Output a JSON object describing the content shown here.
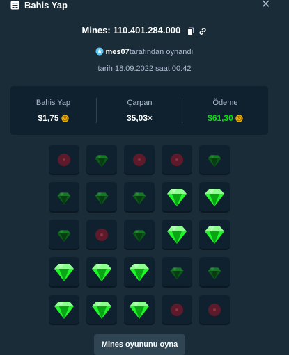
{
  "header": {
    "title": "Bahis Yap",
    "title_icon": "bet-slip-icon",
    "close_icon": "close-icon"
  },
  "bet": {
    "id_text": "Mines: 110.401.284.000"
  },
  "player": {
    "username": "mes07",
    "suffix": "tarafından oynandı"
  },
  "date_text": "tarih 18.09.2022 saat 00:42",
  "stats": {
    "bet_label": "Bahis Yap",
    "bet_value": "$1,75",
    "multiplier_label": "Çarpan",
    "multiplier_value": "35,03×",
    "payout_label": "Ödeme",
    "payout_value": "$61,30"
  },
  "board": {
    "rows": [
      [
        "mine",
        "gem",
        "mine",
        "mine",
        "gem"
      ],
      [
        "gem",
        "gem",
        "gem",
        "gem-revealed",
        "gem-revealed"
      ],
      [
        "gem",
        "mine",
        "gem",
        "gem-revealed",
        "gem-revealed"
      ],
      [
        "gem-revealed",
        "gem-revealed",
        "gem-revealed",
        "gem",
        "gem"
      ],
      [
        "gem-revealed",
        "gem-revealed",
        "gem-revealed",
        "mine",
        "mine"
      ]
    ]
  },
  "play_button": "Mines oyununu oyna",
  "colors": {
    "background": "#1a2c38",
    "panel": "#0f212e",
    "muted_text": "#b1bad3",
    "green": "#00e701",
    "coin": "#f5b400",
    "gem_bright": "#1ff52a",
    "gem_dim": "#0b5a17",
    "mine_dim": "#5c1a2a"
  }
}
